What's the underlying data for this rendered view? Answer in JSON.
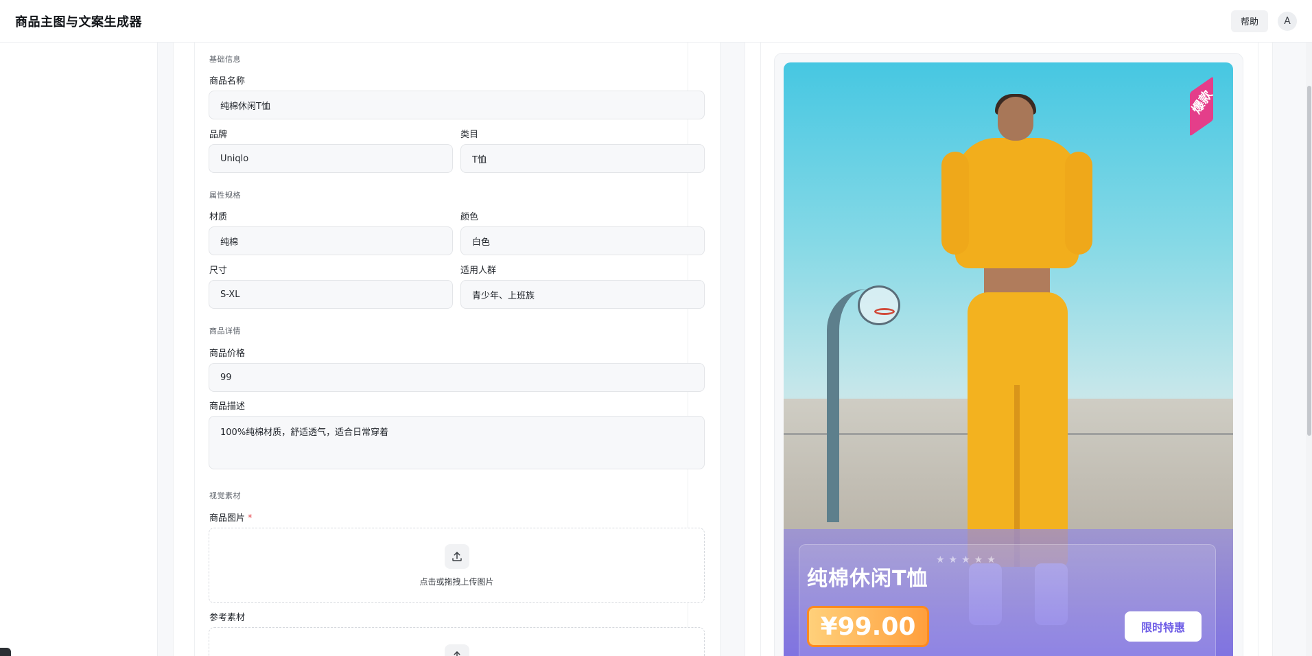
{
  "header": {
    "title": "商品主图与文案生成器",
    "help_label": "帮助",
    "avatar_initial": "A"
  },
  "form": {
    "sections": {
      "basic": "基础信息",
      "attributes": "属性规格",
      "details": "商品详情",
      "visual": "视觉素材"
    },
    "fields": {
      "name": {
        "label": "商品名称",
        "value": "纯棉休闲T恤"
      },
      "brand": {
        "label": "品牌",
        "value": "Uniqlo"
      },
      "category": {
        "label": "类目",
        "value": "T恤"
      },
      "material": {
        "label": "材质",
        "value": "纯棉"
      },
      "color": {
        "label": "颜色",
        "value": "白色"
      },
      "size": {
        "label": "尺寸",
        "value": "S-XL"
      },
      "audience": {
        "label": "适用人群",
        "value": "青少年、上班族"
      },
      "price": {
        "label": "商品价格",
        "value": "99"
      },
      "description": {
        "label": "商品描述",
        "value": "100%纯棉材质，舒适透气，适合日常穿着"
      },
      "product_image": {
        "label": "商品图片",
        "required_mark": "*",
        "upload_text": "点击或拖拽上传图片"
      },
      "reference": {
        "label": "参考素材"
      }
    }
  },
  "preview": {
    "badge": "爆款",
    "stars": "★★★★★",
    "title": "纯棉休闲T恤",
    "price": "¥99.00",
    "promo": "限时特惠"
  },
  "colors": {
    "accent": "#6e5de6",
    "price_badge": "#ff9f3d",
    "ribbon": "#e43e8a",
    "hoodie": "#f2ae1c"
  },
  "icons": {
    "upload": "upload-icon"
  }
}
